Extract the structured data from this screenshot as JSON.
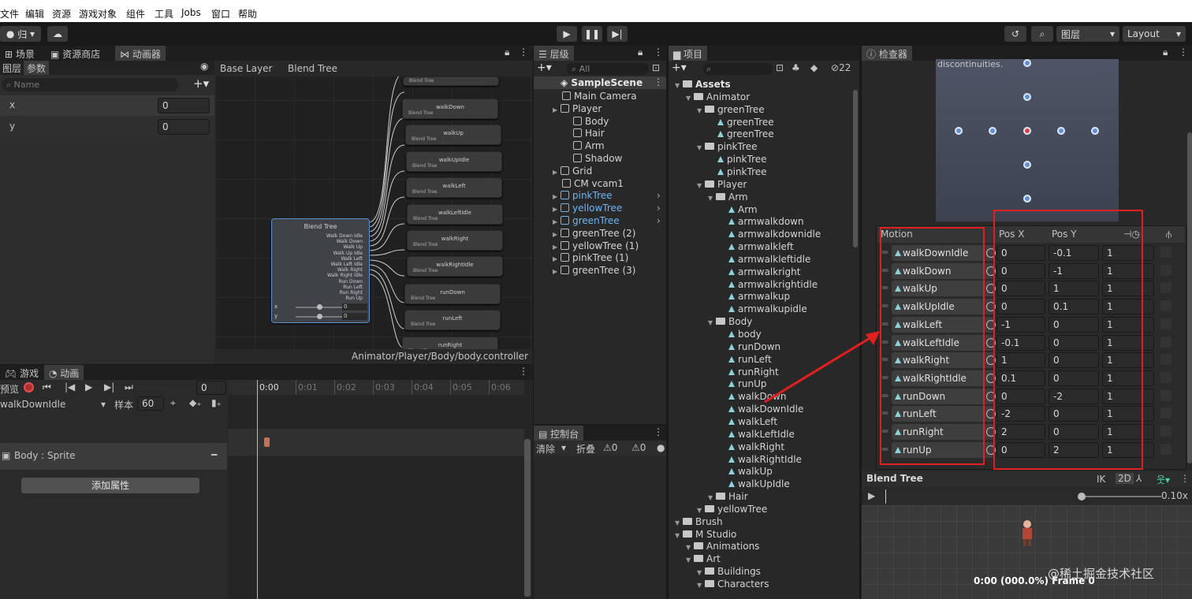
{
  "menu": [
    "文件",
    "编辑",
    "资源",
    "游戏对象",
    "组件",
    "工具",
    "Jobs",
    "窗口",
    "帮助"
  ],
  "toolbar": {
    "account": "归",
    "layers": "图层",
    "layout": "Layout"
  },
  "animator": {
    "tabs": [
      "场景",
      "资源商店",
      "动画器"
    ],
    "subtabs": [
      "图层",
      "参数"
    ],
    "search_placeholder": "Name",
    "params": [
      {
        "name": "x",
        "value": "0"
      },
      {
        "name": "y",
        "value": "0"
      }
    ],
    "breadcrumb": [
      "Base Layer",
      "Blend Tree"
    ],
    "blend_node": {
      "title": "Blend Tree",
      "inputs": [
        "Walk Down Idle",
        "Walk Down",
        "Walk Up",
        "Walk Up Idle",
        "Walk Left",
        "Walk Left Idle",
        "Walk Right",
        "Walk Right Idle",
        "Run Down",
        "Run Left",
        "Run Right",
        "Run Up"
      ],
      "x": "0",
      "y": "0",
      "xl": "x",
      "yl": "y"
    },
    "child_nodes": [
      "walkDown",
      "walkUp",
      "walkUpIdle",
      "walkLeft",
      "walkLeftIdle",
      "walkRight",
      "walkRightIdle",
      "runDown",
      "runLeft",
      "runRight"
    ],
    "node_sub": "Blend Tree",
    "path": "Animator/Player/Body/body.controller"
  },
  "animation": {
    "tabs": [
      "游戏",
      "动画"
    ],
    "preview": "预览",
    "frame": "0",
    "clip": "walkDownIdle",
    "samples_label": "样本",
    "samples": "60",
    "ticks": [
      "0:00",
      "0:01",
      "0:02",
      "0:03",
      "0:04",
      "0:05",
      "0:06"
    ],
    "property": "Body : Sprite",
    "add_property": "添加属性"
  },
  "hierarchy": {
    "tab": "层级",
    "search": "All",
    "scene": "SampleScene",
    "items": [
      {
        "label": "Main Camera",
        "indent": 1,
        "arrow": false,
        "blue": false
      },
      {
        "label": "Player",
        "indent": 1,
        "arrow": true,
        "blue": false
      },
      {
        "label": "Body",
        "indent": 2,
        "arrow": false,
        "blue": false
      },
      {
        "label": "Hair",
        "indent": 2,
        "arrow": false,
        "blue": false
      },
      {
        "label": "Arm",
        "indent": 2,
        "arrow": false,
        "blue": false
      },
      {
        "label": "Shadow",
        "indent": 2,
        "arrow": false,
        "blue": false
      },
      {
        "label": "Grid",
        "indent": 1,
        "arrow": true,
        "blue": false
      },
      {
        "label": "CM vcam1",
        "indent": 1,
        "arrow": false,
        "blue": false
      },
      {
        "label": "pinkTree",
        "indent": 1,
        "arrow": true,
        "blue": true
      },
      {
        "label": "yellowTree",
        "indent": 1,
        "arrow": true,
        "blue": true
      },
      {
        "label": "greenTree",
        "indent": 1,
        "arrow": true,
        "blue": true
      },
      {
        "label": "greenTree (2)",
        "indent": 1,
        "arrow": true,
        "blue": false
      },
      {
        "label": "yellowTree (1)",
        "indent": 1,
        "arrow": true,
        "blue": false
      },
      {
        "label": "pinkTree (1)",
        "indent": 1,
        "arrow": true,
        "blue": false
      },
      {
        "label": "greenTree (3)",
        "indent": 1,
        "arrow": true,
        "blue": false
      }
    ]
  },
  "console": {
    "tab": "控制台",
    "clear": "清除",
    "collapse": "折叠",
    "warn": "0",
    "err": "0"
  },
  "project": {
    "tab": "项目",
    "count": "22",
    "items": [
      {
        "label": "Assets",
        "indent": 0,
        "type": "folder",
        "bold": true
      },
      {
        "label": "Animator",
        "indent": 1,
        "type": "folder"
      },
      {
        "label": "greenTree",
        "indent": 2,
        "type": "folder"
      },
      {
        "label": "greenTree",
        "indent": 3,
        "type": "anim"
      },
      {
        "label": "greenTree",
        "indent": 3,
        "type": "anim"
      },
      {
        "label": "pinkTree",
        "indent": 2,
        "type": "folder"
      },
      {
        "label": "pinkTree",
        "indent": 3,
        "type": "anim"
      },
      {
        "label": "pinkTree",
        "indent": 3,
        "type": "anim"
      },
      {
        "label": "Player",
        "indent": 2,
        "type": "folder"
      },
      {
        "label": "Arm",
        "indent": 3,
        "type": "folder"
      },
      {
        "label": "Arm",
        "indent": 4,
        "type": "anim"
      },
      {
        "label": "armwalkdown",
        "indent": 4,
        "type": "anim"
      },
      {
        "label": "armwalkdownidle",
        "indent": 4,
        "type": "anim"
      },
      {
        "label": "armwalkleft",
        "indent": 4,
        "type": "anim"
      },
      {
        "label": "armwalkleftidle",
        "indent": 4,
        "type": "anim"
      },
      {
        "label": "armwalkright",
        "indent": 4,
        "type": "anim"
      },
      {
        "label": "armwalkrightidle",
        "indent": 4,
        "type": "anim"
      },
      {
        "label": "armwalkup",
        "indent": 4,
        "type": "anim"
      },
      {
        "label": "armwalkupidle",
        "indent": 4,
        "type": "anim"
      },
      {
        "label": "Body",
        "indent": 3,
        "type": "folder"
      },
      {
        "label": "body",
        "indent": 4,
        "type": "anim"
      },
      {
        "label": "runDown",
        "indent": 4,
        "type": "anim"
      },
      {
        "label": "runLeft",
        "indent": 4,
        "type": "anim"
      },
      {
        "label": "runRight",
        "indent": 4,
        "type": "anim"
      },
      {
        "label": "runUp",
        "indent": 4,
        "type": "anim"
      },
      {
        "label": "walkDown",
        "indent": 4,
        "type": "anim"
      },
      {
        "label": "walkDownIdle",
        "indent": 4,
        "type": "anim"
      },
      {
        "label": "walkLeft",
        "indent": 4,
        "type": "anim"
      },
      {
        "label": "walkLeftIdle",
        "indent": 4,
        "type": "anim"
      },
      {
        "label": "walkRight",
        "indent": 4,
        "type": "anim"
      },
      {
        "label": "walkRightIdle",
        "indent": 4,
        "type": "anim"
      },
      {
        "label": "walkUp",
        "indent": 4,
        "type": "anim"
      },
      {
        "label": "walkUpIdle",
        "indent": 4,
        "type": "anim"
      },
      {
        "label": "Hair",
        "indent": 3,
        "type": "folder"
      },
      {
        "label": "yellowTree",
        "indent": 2,
        "type": "folder"
      },
      {
        "label": "Brush",
        "indent": 0,
        "type": "folder"
      },
      {
        "label": "M Studio",
        "indent": 0,
        "type": "folder"
      },
      {
        "label": "Animations",
        "indent": 1,
        "type": "folder"
      },
      {
        "label": "Art",
        "indent": 1,
        "type": "folder"
      },
      {
        "label": "Buildings",
        "indent": 2,
        "type": "folder"
      },
      {
        "label": "Characters",
        "indent": 2,
        "type": "folder"
      }
    ]
  },
  "inspector": {
    "tab": "检查器",
    "discont": "discontinuities.",
    "headers": {
      "motion": "Motion",
      "posx": "Pos X",
      "posy": "Pos Y"
    },
    "motions": [
      {
        "name": "walkDownIdle",
        "x": "0",
        "y": "-0.1",
        "speed": "1"
      },
      {
        "name": "walkDown",
        "x": "0",
        "y": "-1",
        "speed": "1"
      },
      {
        "name": "walkUp",
        "x": "0",
        "y": "1",
        "speed": "1"
      },
      {
        "name": "walkUpIdle",
        "x": "0",
        "y": "0.1",
        "speed": "1"
      },
      {
        "name": "walkLeft",
        "x": "-1",
        "y": "0",
        "speed": "1"
      },
      {
        "name": "walkLeftIdle",
        "x": "-0.1",
        "y": "0",
        "speed": "1"
      },
      {
        "name": "walkRight",
        "x": "1",
        "y": "0",
        "speed": "1"
      },
      {
        "name": "walkRightIdle",
        "x": "0.1",
        "y": "0",
        "speed": "1"
      },
      {
        "name": "runDown",
        "x": "0",
        "y": "-2",
        "speed": "1"
      },
      {
        "name": "runLeft",
        "x": "-2",
        "y": "0",
        "speed": "1"
      },
      {
        "name": "runRight",
        "x": "2",
        "y": "0",
        "speed": "1"
      },
      {
        "name": "runUp",
        "x": "0",
        "y": "2",
        "speed": "1"
      }
    ],
    "preview_title": "Blend Tree",
    "ik": "IK",
    "twod": "2D",
    "speed": "0.10x",
    "status": "0:00 (000.0%) Frame 0",
    "watermark": "@稀土掘金技术社区"
  }
}
